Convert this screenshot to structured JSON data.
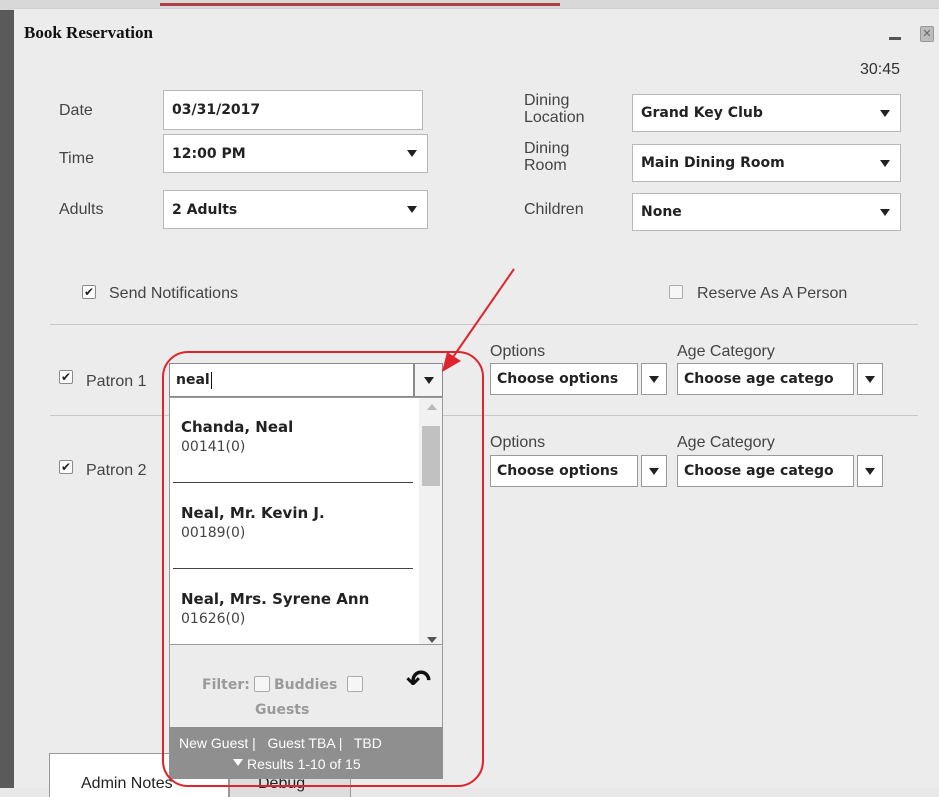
{
  "window": {
    "title": "Book Reservation",
    "timer": "30:45"
  },
  "form": {
    "date": {
      "label": "Date",
      "value": "03/31/2017"
    },
    "time": {
      "label": "Time",
      "value": "12:00 PM"
    },
    "adults": {
      "label": "Adults",
      "value": "2 Adults"
    },
    "dining_location": {
      "label_line1": "Dining",
      "label_line2": "Location",
      "value": "Grand Key Club"
    },
    "dining_room": {
      "label_line1": "Dining",
      "label_line2": "Room",
      "value": "Main Dining Room"
    },
    "children": {
      "label": "Children",
      "value": "None"
    },
    "send_notifications": {
      "label": "Send Notifications",
      "checked": true
    },
    "reserve_as_person": {
      "label": "Reserve As A Person",
      "checked": false
    }
  },
  "patrons": [
    {
      "label": "Patron 1",
      "checked": true,
      "input_value": "neal",
      "options_label": "Options",
      "options_value": "Choose options",
      "age_label": "Age Category",
      "age_value": "Choose age catego"
    },
    {
      "label": "Patron 2",
      "checked": true,
      "options_label": "Options",
      "options_value": "Choose options",
      "age_label": "Age Category",
      "age_value": "Choose age catego"
    }
  ],
  "dropdown": {
    "results": [
      {
        "name": "Chanda, Neal",
        "code": "00141(0)"
      },
      {
        "name": "Neal, Mr. Kevin J.",
        "code": "00189(0)"
      },
      {
        "name": "Neal, Mrs. Syrene Ann",
        "code": "01626(0)"
      }
    ],
    "filter_label": "Filter:",
    "buddies_label": "Buddies",
    "guests_label": "Guests",
    "footer_links": "New Guest |   Guest TBA |   TBD",
    "results_text": "Results 1-10 of 15"
  },
  "tabs": [
    {
      "label": "Admin Notes"
    },
    {
      "label": "Debug"
    }
  ],
  "colors": {
    "annotation": "#e0242c",
    "footer_bg": "#8f8f8f"
  }
}
